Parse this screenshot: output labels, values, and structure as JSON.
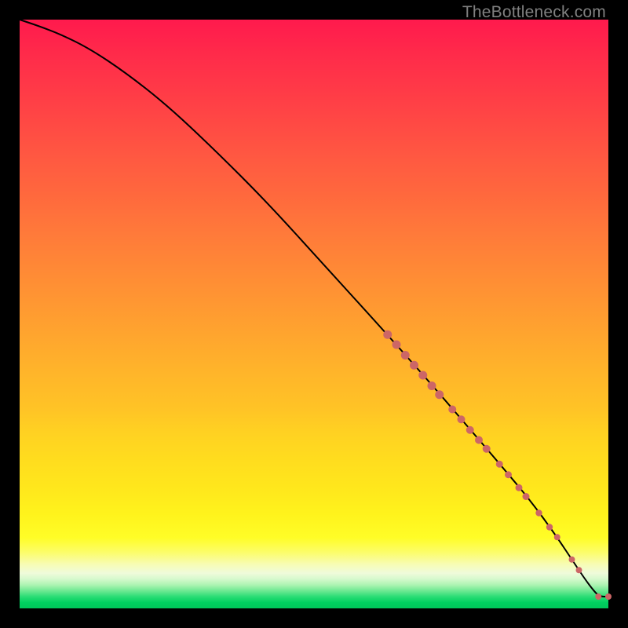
{
  "attribution": "TheBottleneck.com",
  "colors": {
    "marker": "#cc6666",
    "curve": "#000000",
    "frame_bg": "#000000"
  },
  "chart_data": {
    "type": "line",
    "title": "",
    "xlabel": "",
    "ylabel": "",
    "xlim": [
      0,
      100
    ],
    "ylim": [
      0,
      100
    ],
    "grid": false,
    "curve": {
      "x": [
        0,
        3,
        7,
        12,
        18,
        25,
        33,
        42,
        52,
        62,
        70,
        76,
        82,
        87,
        91,
        94,
        96,
        97.5,
        98.5,
        100
      ],
      "y": [
        100,
        99,
        97.5,
        95,
        91,
        85.5,
        78,
        69,
        58,
        47,
        38,
        31,
        24,
        18,
        12.5,
        8,
        5,
        3,
        2,
        2
      ]
    },
    "markers": [
      {
        "x": 62.5,
        "y": 46.5,
        "r": 5.5
      },
      {
        "x": 64.0,
        "y": 44.8,
        "r": 5.5
      },
      {
        "x": 65.5,
        "y": 43.0,
        "r": 5.5
      },
      {
        "x": 67.0,
        "y": 41.3,
        "r": 5.5
      },
      {
        "x": 68.5,
        "y": 39.6,
        "r": 5.5
      },
      {
        "x": 70.0,
        "y": 37.8,
        "r": 5.5
      },
      {
        "x": 71.3,
        "y": 36.3,
        "r": 5.5
      },
      {
        "x": 73.5,
        "y": 33.8,
        "r": 5.0
      },
      {
        "x": 75.0,
        "y": 32.1,
        "r": 5.0
      },
      {
        "x": 76.5,
        "y": 30.3,
        "r": 5.0
      },
      {
        "x": 78.0,
        "y": 28.6,
        "r": 5.0
      },
      {
        "x": 79.3,
        "y": 27.1,
        "r": 5.0
      },
      {
        "x": 81.5,
        "y": 24.5,
        "r": 4.5
      },
      {
        "x": 83.0,
        "y": 22.7,
        "r": 4.5
      },
      {
        "x": 84.8,
        "y": 20.5,
        "r": 4.5
      },
      {
        "x": 86.0,
        "y": 19.0,
        "r": 4.5
      },
      {
        "x": 88.2,
        "y": 16.2,
        "r": 4.2
      },
      {
        "x": 90.0,
        "y": 13.8,
        "r": 4.2
      },
      {
        "x": 91.3,
        "y": 12.1,
        "r": 4.0
      },
      {
        "x": 93.8,
        "y": 8.3,
        "r": 4.0
      },
      {
        "x": 95.0,
        "y": 6.5,
        "r": 4.0
      },
      {
        "x": 98.3,
        "y": 2.0,
        "r": 4.0
      },
      {
        "x": 100.0,
        "y": 2.0,
        "r": 4.0
      }
    ]
  }
}
